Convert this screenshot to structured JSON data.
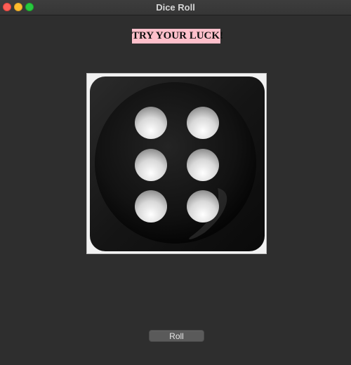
{
  "window": {
    "title": "Dice Roll"
  },
  "heading": {
    "text": "TRY YOUR LUCK!",
    "background_color": "#ffc0cb"
  },
  "dice": {
    "face_value": 6,
    "body_color": "#141414",
    "pip_color": "#e8e8e8"
  },
  "roll_button": {
    "label": "Roll"
  }
}
